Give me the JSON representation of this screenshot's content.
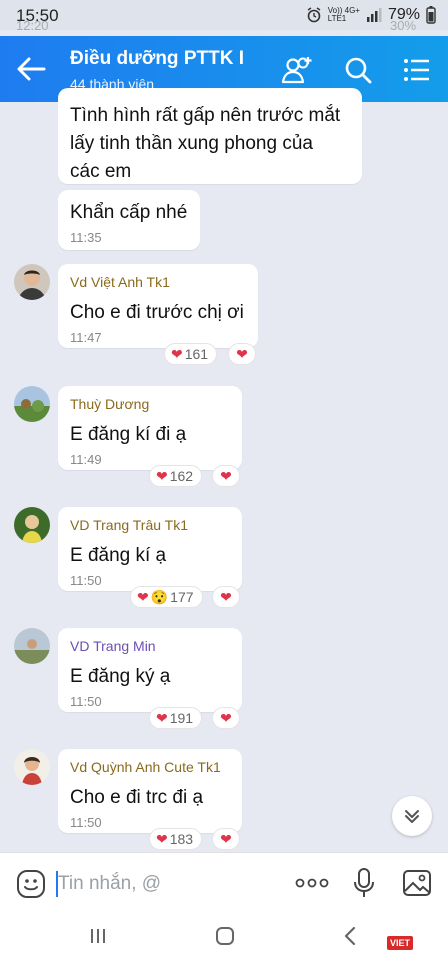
{
  "status_bar": {
    "time": "15:50",
    "battery": "79%",
    "network_top": "Vo)) 4G+",
    "network_bottom": "LTE1",
    "ghost_time": "12:20",
    "ghost_battery": "30%"
  },
  "header": {
    "title": "Điều dưỡng PTTK I",
    "subtitle": "44 thành viên"
  },
  "messages": [
    {
      "text_lines": [
        "Tình hình rất gấp nên trước mắt",
        "lấy tinh thần xung phong của",
        "các em"
      ]
    },
    {
      "text": "Khẩn cấp nhé",
      "time": "11:35"
    },
    {
      "sender": "Vd Việt Anh Tk1",
      "text": "Cho e đi trước chị ơi",
      "time": "11:47",
      "reactions": 161
    },
    {
      "sender": "Thuỳ Dương",
      "text": "E đăng kí đi ạ",
      "time": "11:49",
      "reactions": 162
    },
    {
      "sender": "VD Trang Trâu Tk1",
      "text": "E đăng kí ạ",
      "time": "11:50",
      "reactions": 177
    },
    {
      "sender": "VD Trang Min",
      "text": "E đăng ký ạ",
      "time": "11:50",
      "reactions": 191
    },
    {
      "sender": "Vd Quỳnh Anh Cute Tk1",
      "text": "Cho e đi trc đi ạ",
      "time": "11:50",
      "reactions": 183
    }
  ],
  "composer": {
    "placeholder": "Tin nhắn, @"
  },
  "watermark": {
    "text": "VIET"
  },
  "colors": {
    "header_start": "#1f7cf0",
    "header_end": "#139dea",
    "heart": "#e0344a",
    "background": "#e6e9f2"
  },
  "icons": [
    "back-arrow-icon",
    "add-member-icon",
    "search-icon",
    "menu-icon",
    "sticker-icon",
    "more-icon",
    "mic-icon",
    "image-icon",
    "chevron-down-icon"
  ]
}
